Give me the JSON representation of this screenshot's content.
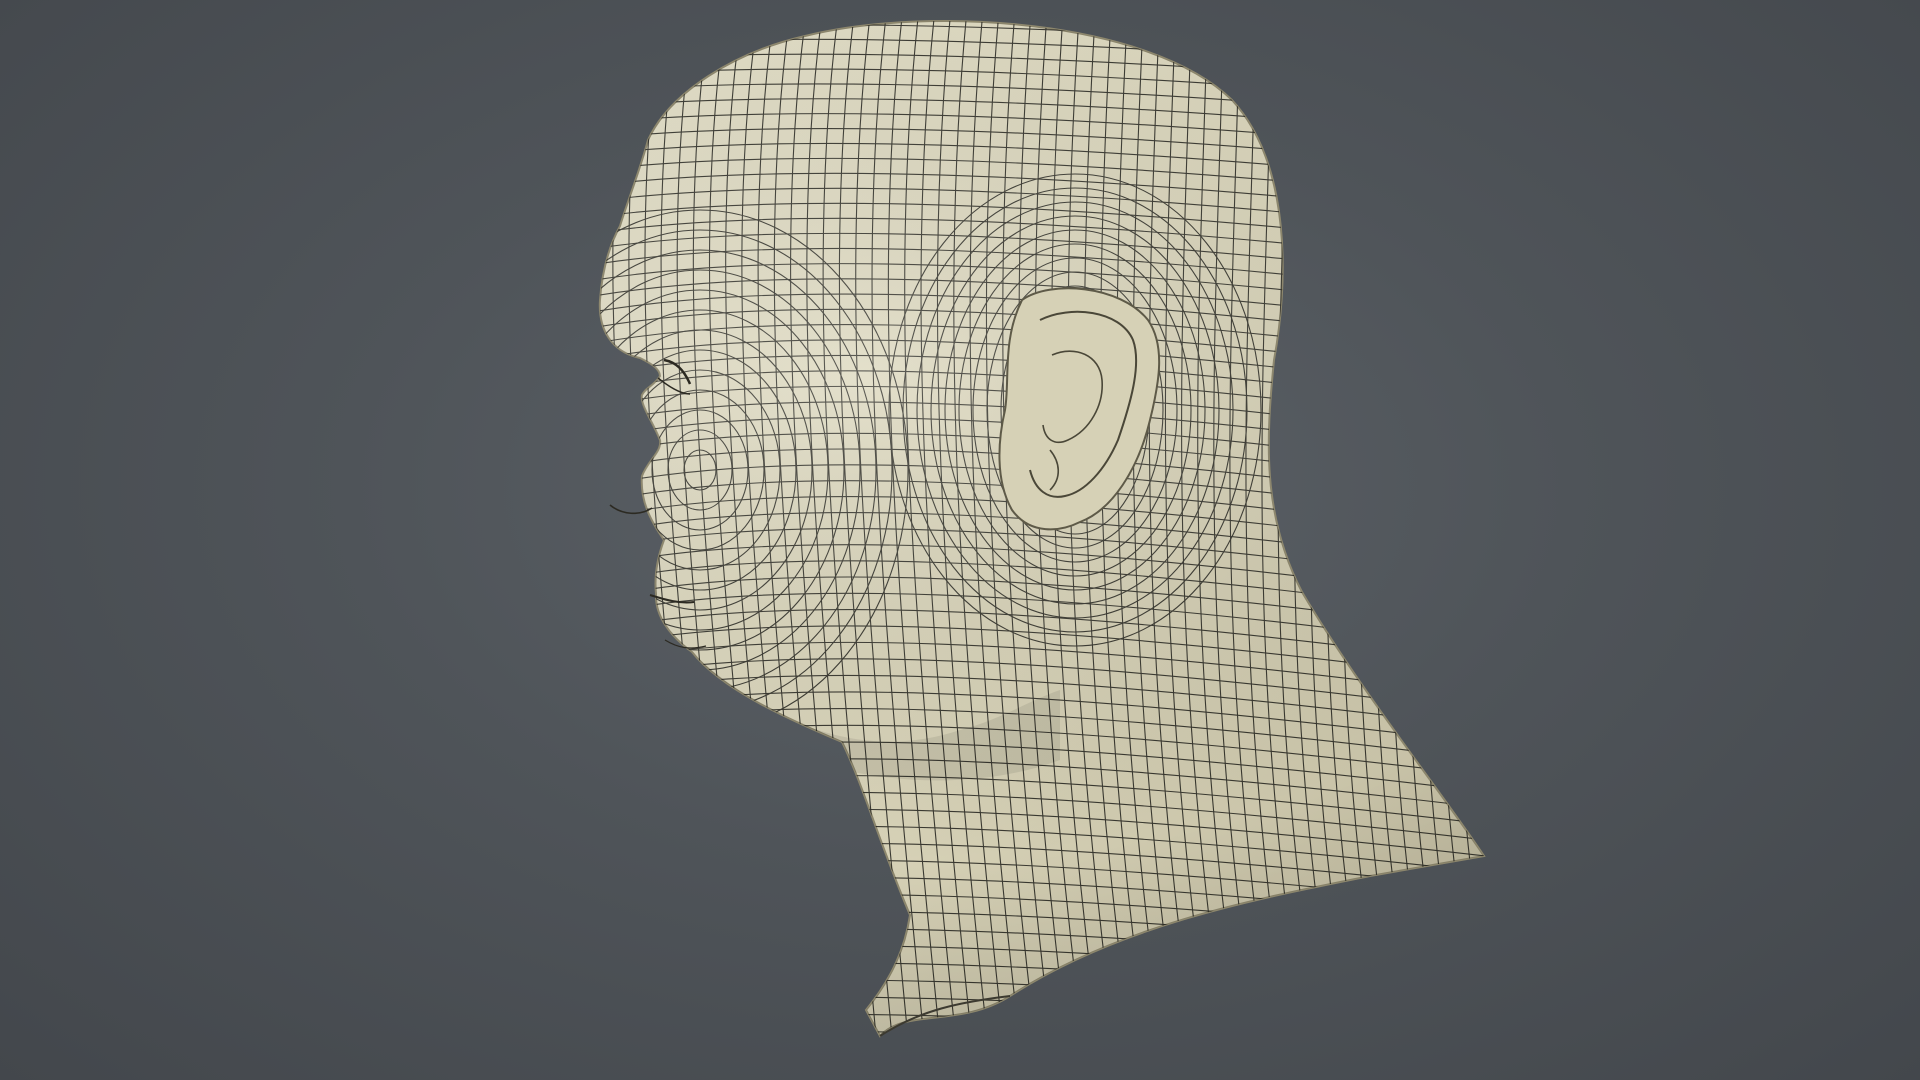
{
  "scene": {
    "subject": "head-neck-wireframe-model",
    "view": "left-profile",
    "colors": {
      "background_center": "#5c6167",
      "background_edge": "#43474c",
      "surface_light": "#e3dfc7",
      "surface_mid": "#cfc9ad",
      "surface_shadow": "#a59f86",
      "wire": "#1f1f1a"
    }
  }
}
